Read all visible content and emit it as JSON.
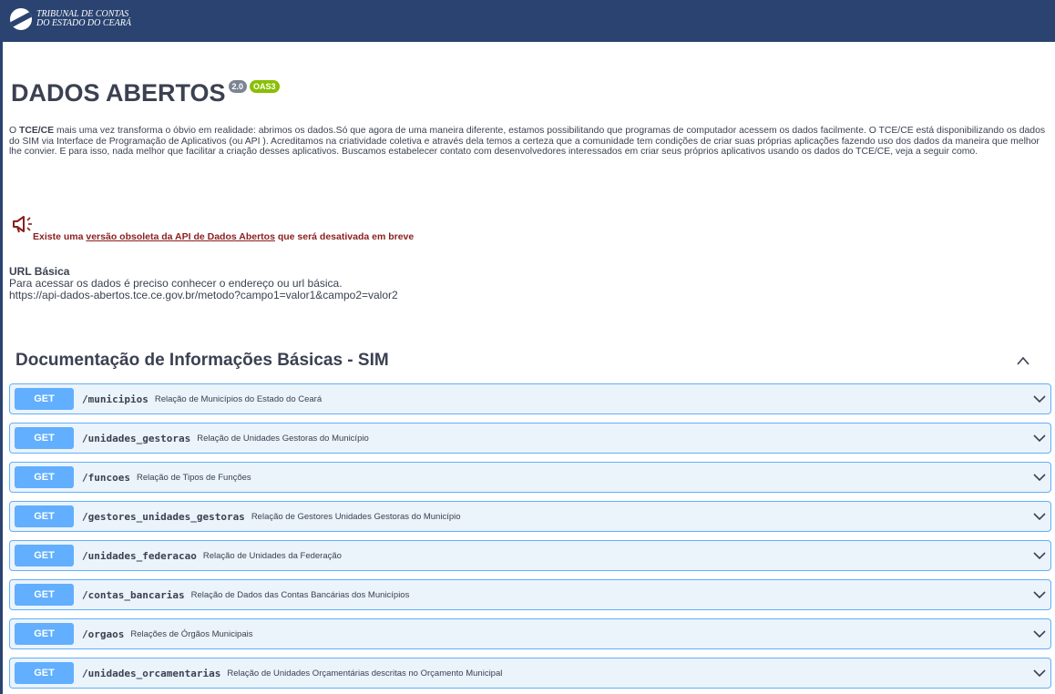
{
  "header": {
    "org_line1": "TRIBUNAL DE CONTAS",
    "org_line2": "DO ESTADO DO CEARÁ",
    "brand_color": "#2a4370"
  },
  "title": {
    "text": "DADOS ABERTOS",
    "version_badge": "2.0",
    "oas_badge": "OAS3"
  },
  "intro": {
    "prefix": "O ",
    "bold": "TCE/CE",
    "text": " mais uma vez transforma o óbvio em realidade: abrimos os dados.Só que agora de uma maneira diferente, estamos possibilitando que programas de computador acessem os dados facilmente. O TCE/CE está disponibilizando os dados do SIM via Interface de Programação de Aplicativos (ou API ). Acreditamos na criatividade coletiva e através dela temos a certeza que a comunidade tem condições de criar suas próprias aplicações fazendo uso dos dados da maneira que melhor lhe convier. E para isso, nada melhor que facilitar a criação desses aplicativos. Buscamos estabelecer contato com desenvolvedores interessados em criar seus próprios aplicativos usando os dados do TCE/CE, veja a seguir como."
  },
  "notice": {
    "icon": "megaphone-icon",
    "before": "Existe uma ",
    "link": "versão obsoleta da API de Dados Abertos",
    "after": " que será desativada em breve",
    "color": "#8b1e1e"
  },
  "base_url": {
    "label": "URL Básica",
    "description": "Para acessar os dados é preciso conhecer o endereço ou url básica.",
    "url": "https://api-dados-abertos.tce.ce.gov.br/metodo?campo1=valor1&campo2=valor2"
  },
  "section": {
    "title": "Documentação de Informações Básicas - SIM",
    "toggle_icon": "chevron-up-icon"
  },
  "operations": [
    {
      "method": "GET",
      "path": "/municipios",
      "description": "Relação de Municípios do Estado do Ceará"
    },
    {
      "method": "GET",
      "path": "/unidades_gestoras",
      "description": "Relação de Unidades Gestoras do Município"
    },
    {
      "method": "GET",
      "path": "/funcoes",
      "description": "Relação de Tipos de Funções"
    },
    {
      "method": "GET",
      "path": "/gestores_unidades_gestoras",
      "description": "Relação de Gestores Unidades Gestoras do Município"
    },
    {
      "method": "GET",
      "path": "/unidades_federacao",
      "description": "Relação de Unidades da Federação"
    },
    {
      "method": "GET",
      "path": "/contas_bancarias",
      "description": "Relação de Dados das Contas Bancárias dos Municípios"
    },
    {
      "method": "GET",
      "path": "/orgaos",
      "description": "Relações de Órgãos Municipais"
    },
    {
      "method": "GET",
      "path": "/unidades_orcamentarias",
      "description": "Relação de Unidades Orçamentárias descritas no Orçamento Municipal"
    }
  ],
  "colors": {
    "get_method": "#61affe",
    "get_background": "#ebf3fb",
    "oas_badge": "#89bf04",
    "version_badge": "#7d8492"
  }
}
